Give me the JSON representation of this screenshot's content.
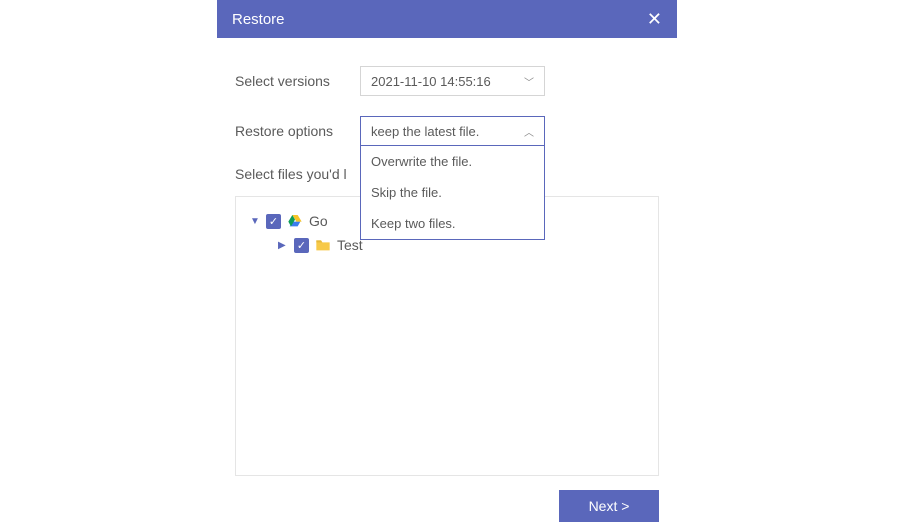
{
  "header": {
    "title": "Restore"
  },
  "form": {
    "select_versions_label": "Select versions",
    "selected_version": "2021-11-10 14:55:16",
    "restore_options_label": "Restore options",
    "selected_restore_option": "keep the latest file.",
    "restore_dropdown": [
      "Overwrite the file.",
      "Skip the file.",
      "Keep two files."
    ]
  },
  "section": {
    "select_files_label": "Select files you'd l"
  },
  "tree": {
    "root": {
      "label": "Go",
      "checked": true,
      "expanded": true
    },
    "child": {
      "label": "Test",
      "checked": true,
      "expanded": false
    }
  },
  "footer": {
    "next_label": "Next >"
  }
}
